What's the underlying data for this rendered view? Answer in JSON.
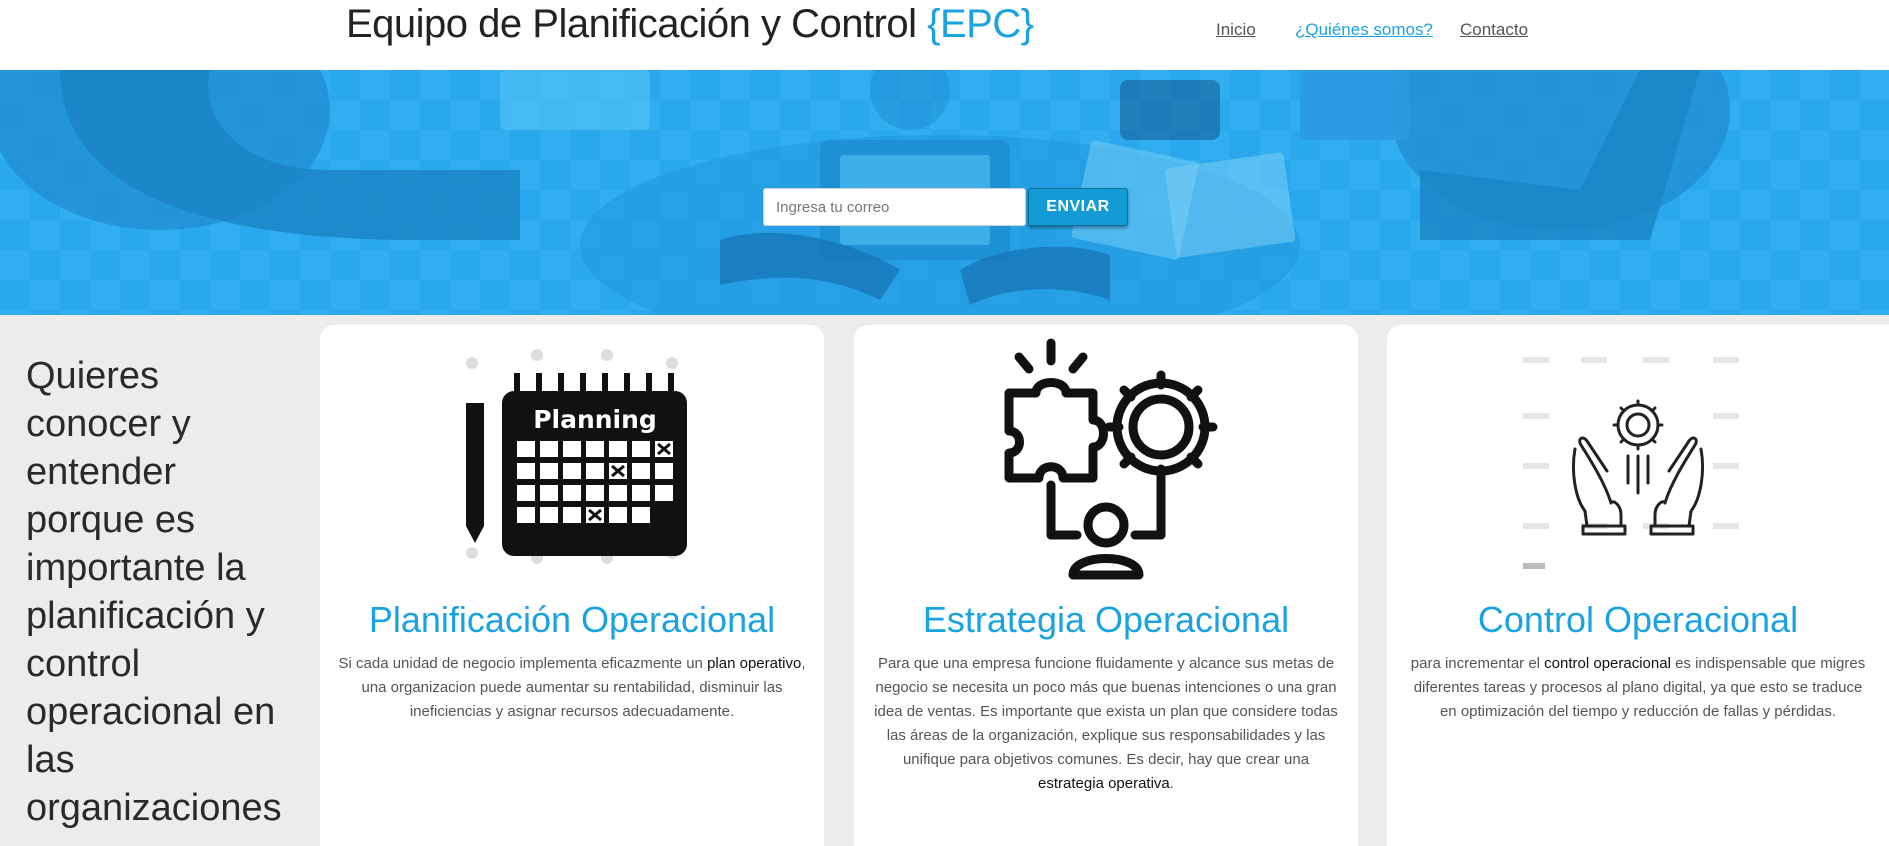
{
  "header": {
    "brand_main": "Equipo de Planificación y Control",
    "brand_accent": "{EPC}",
    "nav": [
      "Inicio",
      "¿Quiénes somos?",
      "Contacto"
    ]
  },
  "hero": {
    "email_placeholder": "Ingresa tu correo",
    "send_label": "ENVIAR"
  },
  "intro": {
    "text": "Quieres conocer y entender porque es importante la planificación y control operacional en las organizaciones"
  },
  "cards": [
    {
      "title": "Planificación Operacional",
      "icon": "planning-calendar-icon",
      "icon_text": "Planning",
      "text_before": "Si cada unidad de negocio implementa eficazmente un ",
      "text_strong": "plan operativo",
      "text_after": ", una organizacion puede aumentar su rentabilidad, disminuir las ineficiencias y asignar recursos adecuadamente."
    },
    {
      "title": "Estrategia Operacional",
      "icon": "strategy-puzzle-gear-icon",
      "text_before": "Para que una empresa funcione fluidamente y alcance sus metas de negocio se necesita un poco más que buenas intenciones o una gran idea de ventas. Es importante que exista un plan que considere todas las áreas de la organización, explique sus responsabilidades y las unifique para objetivos comunes. Es decir, hay que crear una ",
      "text_strong": "estrategia operativa",
      "text_after": "."
    },
    {
      "title": "Control Operacional",
      "icon": "control-hands-gear-icon",
      "text_before": "para incrementar el ",
      "text_strong": "control operacional",
      "text_after": " es indispensable que migres diferentes tareas y procesos al plano digital, ya que esto se traduce en optimización del tiempo y reducción de fallas y pérdidas."
    }
  ],
  "colors": {
    "accent": "#1aa3e0",
    "hero_bg": "#2aa8ee",
    "button_bg": "#129bd4"
  }
}
